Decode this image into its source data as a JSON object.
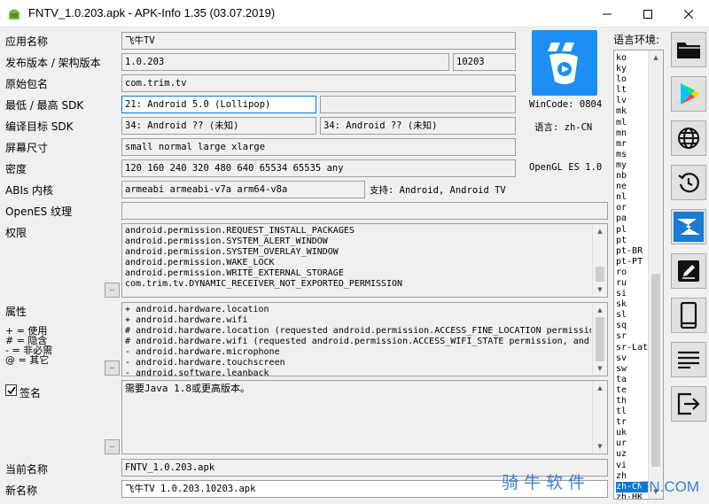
{
  "window": {
    "title": "FNTV_1.0.203.apk - APK-Info 1.35 (03.07.2019)"
  },
  "fields": {
    "app_name": {
      "label": "应用名称",
      "value": "飞牛TV"
    },
    "version": {
      "label": "发布版本 / 架构版本",
      "name": "1.0.203",
      "code": "10203"
    },
    "package": {
      "label": "原始包名",
      "value": "com.trim.tv"
    },
    "min_sdk": {
      "label": "最低 / 最高 SDK",
      "min": "21: Android 5.0 (Lollipop)",
      "max": ""
    },
    "target_sdk": {
      "label": "编译目标 SDK",
      "target": "34: Android ?? (未知)",
      "compile": "34: Android ?? (未知)"
    },
    "screens": {
      "label": "屏幕尺寸",
      "value": "small normal large xlarge"
    },
    "density": {
      "label": "密度",
      "value": "120 160 240 320 480 640 65534 65535 any"
    },
    "abis": {
      "label": "ABIs 内核",
      "value": "armeabi armeabi-v7a arm64-v8a",
      "support": "支持: Android, Android TV"
    },
    "opengl_textures": {
      "label": "OpenES 纹理",
      "value": ""
    },
    "permissions": {
      "label": "权限",
      "dots": "..",
      "lines": [
        "android.permission.REQUEST_INSTALL_PACKAGES",
        "android.permission.SYSTEM_ALERT_WINDOW",
        "android.permission.SYSTEM_OVERLAY_WINDOW",
        "android.permission.WAKE_LOCK",
        "android.permission.WRITE_EXTERNAL_STORAGE",
        "com.trim.tv.DYNAMIC_RECEIVER_NOT_EXPORTED_PERMISSION"
      ]
    },
    "features": {
      "label": "属性",
      "dots": "..",
      "legend": [
        "+ = 使用",
        "# = 隐含",
        "- = 非必需",
        "@ = 其它"
      ],
      "lines": [
        "+ android.hardware.location",
        "+ android.hardware.wifi",
        "# android.hardware.location (requested android.permission.ACCESS_FINE_LOCATION permissio",
        "# android.hardware.wifi (requested android.permission.ACCESS_WIFI_STATE permission, and",
        "- android.hardware.microphone",
        "- android.hardware.touchscreen",
        "- android.software.leanback"
      ]
    },
    "signature": {
      "label": "签名",
      "checked": true,
      "dots": "..",
      "text": "需要Java 1.8或更高版本。"
    },
    "current_name": {
      "label": "当前名称",
      "value": "FNTV_1.0.203.apk"
    },
    "new_name": {
      "label": "新名称",
      "value": "飞牛TV 1.0.203.10203.apk"
    }
  },
  "info": {
    "wincode": "WinCode: 0804",
    "language": "语言: zh-CN",
    "opengl": "OpenGL ES 1.0"
  },
  "languages": {
    "label": "语言环境:",
    "items": [
      "ko",
      "ky",
      "lo",
      "lt",
      "lv",
      "mk",
      "ml",
      "mn",
      "mr",
      "ms",
      "my",
      "nb",
      "ne",
      "nl",
      "or",
      "pa",
      "pl",
      "pt",
      "pt-BR",
      "pt-PT",
      "ro",
      "ru",
      "si",
      "sk",
      "sl",
      "sq",
      "sr",
      "sr-Latn",
      "sv",
      "sw",
      "ta",
      "te",
      "th",
      "tl",
      "tr",
      "uk",
      "ur",
      "uz",
      "vi",
      "zh",
      "zh-CN",
      "zh-HK"
    ],
    "selected": "zh-CN"
  },
  "toolbar": [
    "folder-icon",
    "play-store-icon",
    "globe-icon",
    "history-icon",
    "apk-tool-icon",
    "edit-icon",
    "phone-icon",
    "list-icon",
    "exit-icon"
  ],
  "watermark": {
    "cn": "骑牛软件",
    "en": "FN.COM"
  },
  "colors": {
    "accent": "#0078d7",
    "app_icon_bg": "#1e8ff2"
  }
}
